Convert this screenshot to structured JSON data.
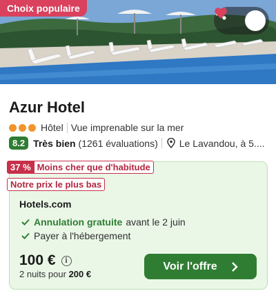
{
  "hero": {
    "badge": "Choix populaire",
    "share_icon": "share-icon",
    "favorite_icon": "heart-icon"
  },
  "hotel": {
    "name": "Azur Hotel",
    "stars_icon": "rating-dots",
    "type": "Hôtel",
    "highlight": "Vue imprenable sur la mer",
    "score": "8.2",
    "rating_label": "Très bien",
    "reviews": "(1261 évaluations)",
    "location": "Le Lavandou, à 5...."
  },
  "deal": {
    "discount": "37 %",
    "discount_text": "Moins cher que d'habitude",
    "best_price": "Notre prix le plus bas",
    "provider": "Hotels.com",
    "features": [
      {
        "bold": "Annulation gratuite",
        "text": "avant le 2 juin"
      },
      {
        "bold": "",
        "text": "Payer à l'hébergement"
      }
    ],
    "price": "100 €",
    "nights_prefix": "2 nuits pour",
    "nights_total": "200 €",
    "cta_label": "Voir l'offre"
  },
  "colors": {
    "accent_green": "#2f7d32",
    "deal_bg": "#eaf7e7",
    "badge_red": "#d9415d",
    "tag_red": "#c7304a",
    "dot_orange": "#f0952a"
  }
}
